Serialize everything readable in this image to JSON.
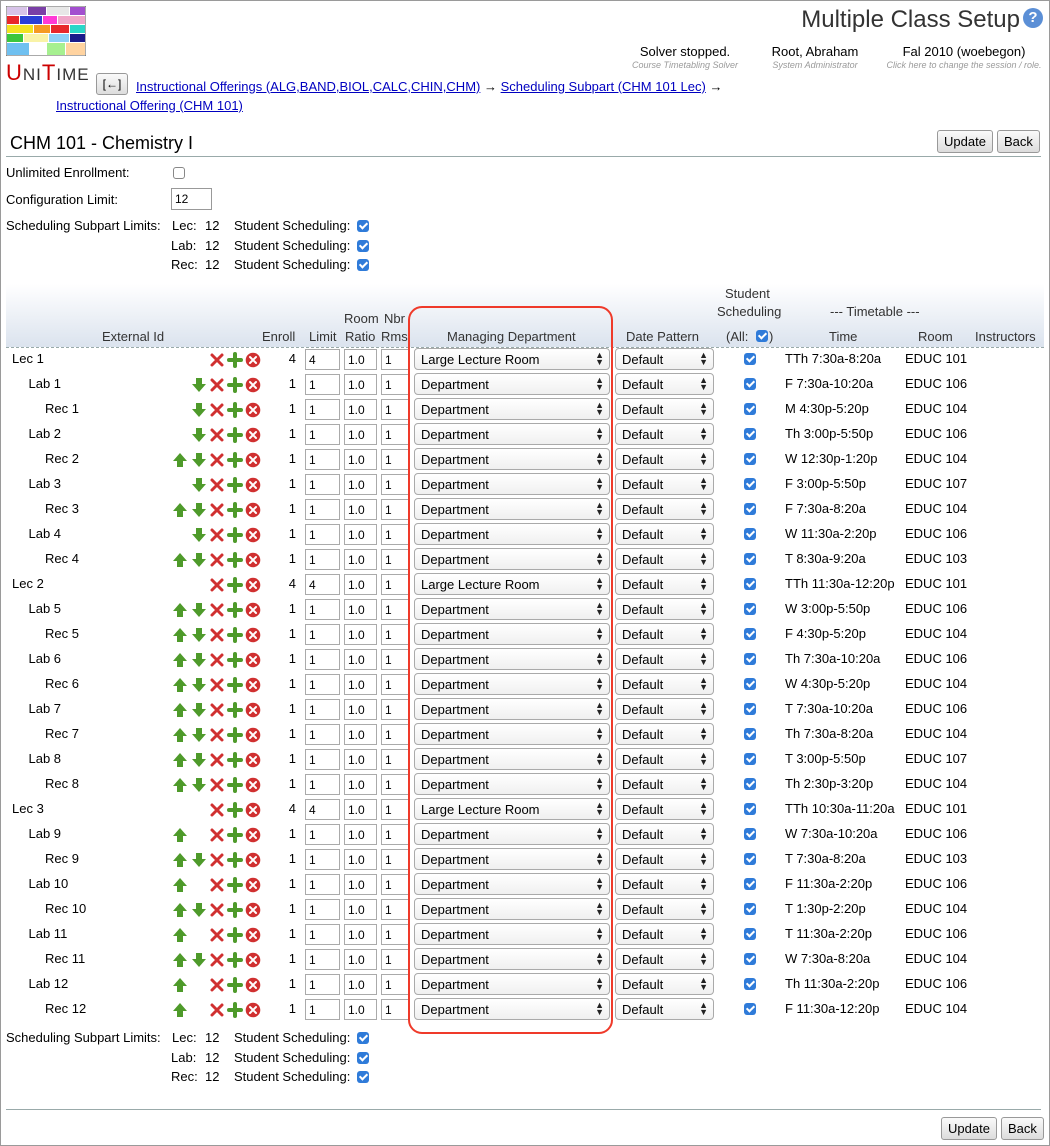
{
  "header": {
    "title": "Multiple Class Setup",
    "logo_text": "UniTime",
    "solver": {
      "main": "Solver stopped.",
      "sub": "Course Timetabling Solver"
    },
    "user": {
      "main": "Root, Abraham",
      "sub": "System Administrator"
    },
    "session": {
      "main": "Fal 2010 (woebegon)",
      "sub": "Click here to change the session / role."
    },
    "help": "?"
  },
  "nav": {
    "back_label": "[←]",
    "crumb1": "Instructional Offerings (ALG,BAND,BIOL,CALC,CHIN,CHM)",
    "sep": "→",
    "crumb2": "Scheduling Subpart (CHM 101 Lec)",
    "crumb3": "Instructional Offering (CHM 101)"
  },
  "course_title": "CHM 101 - Chemistry I",
  "buttons": {
    "update": "Update",
    "back": "Back"
  },
  "form": {
    "unlimited_label": "Unlimited Enrollment:",
    "config_label": "Configuration Limit:",
    "config_value": "12",
    "subpart_limits_label": "Scheduling Subpart Limits:",
    "student_scheduling_label": "Student Scheduling:",
    "subpart_limits": [
      {
        "type": "Lec:",
        "limit": "12"
      },
      {
        "type": "Lab:",
        "limit": "12"
      },
      {
        "type": "Rec:",
        "limit": "12"
      }
    ]
  },
  "table": {
    "headers": {
      "external_id": "External Id",
      "enroll": "Enroll",
      "limit": "Limit",
      "room_ratio_1": "Room",
      "room_ratio_2": "Ratio",
      "nbr_rms_1": "Nbr",
      "nbr_rms_2": "Rms",
      "managing_dept": "Managing Department",
      "date_pattern": "Date Pattern",
      "student_sched_1": "Student",
      "student_sched_2": "Scheduling",
      "all_open": "(All:",
      "all_close": ")",
      "timetable": "--- Timetable ---",
      "time": "Time",
      "room": "Room",
      "instructors": "Instructors"
    },
    "rows": [
      {
        "name": "Lec 1",
        "indent": 0,
        "up": false,
        "down": false,
        "enroll": "4",
        "limit": "4",
        "ratio": "1.0",
        "rooms": "1",
        "dept": "Large Lecture Room",
        "date": "Default",
        "time": "TTh 7:30a-8:20a",
        "room": "EDUC 101"
      },
      {
        "name": "Lab 1",
        "indent": 1,
        "up": false,
        "down": true,
        "enroll": "1",
        "limit": "1",
        "ratio": "1.0",
        "rooms": "1",
        "dept": "Department",
        "date": "Default",
        "time": "F 7:30a-10:20a",
        "room": "EDUC 106"
      },
      {
        "name": "Rec 1",
        "indent": 2,
        "up": false,
        "down": true,
        "enroll": "1",
        "limit": "1",
        "ratio": "1.0",
        "rooms": "1",
        "dept": "Department",
        "date": "Default",
        "time": "M 4:30p-5:20p",
        "room": "EDUC 104"
      },
      {
        "name": "Lab 2",
        "indent": 1,
        "up": false,
        "down": true,
        "enroll": "1",
        "limit": "1",
        "ratio": "1.0",
        "rooms": "1",
        "dept": "Department",
        "date": "Default",
        "time": "Th 3:00p-5:50p",
        "room": "EDUC 106"
      },
      {
        "name": "Rec 2",
        "indent": 2,
        "up": true,
        "down": true,
        "enroll": "1",
        "limit": "1",
        "ratio": "1.0",
        "rooms": "1",
        "dept": "Department",
        "date": "Default",
        "time": "W 12:30p-1:20p",
        "room": "EDUC 104"
      },
      {
        "name": "Lab 3",
        "indent": 1,
        "up": false,
        "down": true,
        "enroll": "1",
        "limit": "1",
        "ratio": "1.0",
        "rooms": "1",
        "dept": "Department",
        "date": "Default",
        "time": "F 3:00p-5:50p",
        "room": "EDUC 107"
      },
      {
        "name": "Rec 3",
        "indent": 2,
        "up": true,
        "down": true,
        "enroll": "1",
        "limit": "1",
        "ratio": "1.0",
        "rooms": "1",
        "dept": "Department",
        "date": "Default",
        "time": "F 7:30a-8:20a",
        "room": "EDUC 104"
      },
      {
        "name": "Lab 4",
        "indent": 1,
        "up": false,
        "down": true,
        "enroll": "1",
        "limit": "1",
        "ratio": "1.0",
        "rooms": "1",
        "dept": "Department",
        "date": "Default",
        "time": "W 11:30a-2:20p",
        "room": "EDUC 106"
      },
      {
        "name": "Rec 4",
        "indent": 2,
        "up": true,
        "down": true,
        "enroll": "1",
        "limit": "1",
        "ratio": "1.0",
        "rooms": "1",
        "dept": "Department",
        "date": "Default",
        "time": "T 8:30a-9:20a",
        "room": "EDUC 103"
      },
      {
        "name": "Lec 2",
        "indent": 0,
        "up": false,
        "down": false,
        "enroll": "4",
        "limit": "4",
        "ratio": "1.0",
        "rooms": "1",
        "dept": "Large Lecture Room",
        "date": "Default",
        "time": "TTh 11:30a-12:20p",
        "room": "EDUC 101"
      },
      {
        "name": "Lab 5",
        "indent": 1,
        "up": true,
        "down": true,
        "enroll": "1",
        "limit": "1",
        "ratio": "1.0",
        "rooms": "1",
        "dept": "Department",
        "date": "Default",
        "time": "W 3:00p-5:50p",
        "room": "EDUC 106"
      },
      {
        "name": "Rec 5",
        "indent": 2,
        "up": true,
        "down": true,
        "enroll": "1",
        "limit": "1",
        "ratio": "1.0",
        "rooms": "1",
        "dept": "Department",
        "date": "Default",
        "time": "F 4:30p-5:20p",
        "room": "EDUC 104"
      },
      {
        "name": "Lab 6",
        "indent": 1,
        "up": true,
        "down": true,
        "enroll": "1",
        "limit": "1",
        "ratio": "1.0",
        "rooms": "1",
        "dept": "Department",
        "date": "Default",
        "time": "Th 7:30a-10:20a",
        "room": "EDUC 106"
      },
      {
        "name": "Rec 6",
        "indent": 2,
        "up": true,
        "down": true,
        "enroll": "1",
        "limit": "1",
        "ratio": "1.0",
        "rooms": "1",
        "dept": "Department",
        "date": "Default",
        "time": "W 4:30p-5:20p",
        "room": "EDUC 104"
      },
      {
        "name": "Lab 7",
        "indent": 1,
        "up": true,
        "down": true,
        "enroll": "1",
        "limit": "1",
        "ratio": "1.0",
        "rooms": "1",
        "dept": "Department",
        "date": "Default",
        "time": "T 7:30a-10:20a",
        "room": "EDUC 106"
      },
      {
        "name": "Rec 7",
        "indent": 2,
        "up": true,
        "down": true,
        "enroll": "1",
        "limit": "1",
        "ratio": "1.0",
        "rooms": "1",
        "dept": "Department",
        "date": "Default",
        "time": "Th 7:30a-8:20a",
        "room": "EDUC 104"
      },
      {
        "name": "Lab 8",
        "indent": 1,
        "up": true,
        "down": true,
        "enroll": "1",
        "limit": "1",
        "ratio": "1.0",
        "rooms": "1",
        "dept": "Department",
        "date": "Default",
        "time": "T 3:00p-5:50p",
        "room": "EDUC 107"
      },
      {
        "name": "Rec 8",
        "indent": 2,
        "up": true,
        "down": true,
        "enroll": "1",
        "limit": "1",
        "ratio": "1.0",
        "rooms": "1",
        "dept": "Department",
        "date": "Default",
        "time": "Th 2:30p-3:20p",
        "room": "EDUC 104"
      },
      {
        "name": "Lec 3",
        "indent": 0,
        "up": false,
        "down": false,
        "enroll": "4",
        "limit": "4",
        "ratio": "1.0",
        "rooms": "1",
        "dept": "Large Lecture Room",
        "date": "Default",
        "time": "TTh 10:30a-11:20a",
        "room": "EDUC 101"
      },
      {
        "name": "Lab 9",
        "indent": 1,
        "up": true,
        "down": false,
        "enroll": "1",
        "limit": "1",
        "ratio": "1.0",
        "rooms": "1",
        "dept": "Department",
        "date": "Default",
        "time": "W 7:30a-10:20a",
        "room": "EDUC 106"
      },
      {
        "name": "Rec 9",
        "indent": 2,
        "up": true,
        "down": true,
        "enroll": "1",
        "limit": "1",
        "ratio": "1.0",
        "rooms": "1",
        "dept": "Department",
        "date": "Default",
        "time": "T 7:30a-8:20a",
        "room": "EDUC 103"
      },
      {
        "name": "Lab 10",
        "indent": 1,
        "up": true,
        "down": false,
        "enroll": "1",
        "limit": "1",
        "ratio": "1.0",
        "rooms": "1",
        "dept": "Department",
        "date": "Default",
        "time": "F 11:30a-2:20p",
        "room": "EDUC 106"
      },
      {
        "name": "Rec 10",
        "indent": 2,
        "up": true,
        "down": true,
        "enroll": "1",
        "limit": "1",
        "ratio": "1.0",
        "rooms": "1",
        "dept": "Department",
        "date": "Default",
        "time": "T 1:30p-2:20p",
        "room": "EDUC 104"
      },
      {
        "name": "Lab 11",
        "indent": 1,
        "up": true,
        "down": false,
        "enroll": "1",
        "limit": "1",
        "ratio": "1.0",
        "rooms": "1",
        "dept": "Department",
        "date": "Default",
        "time": "T 11:30a-2:20p",
        "room": "EDUC 106"
      },
      {
        "name": "Rec 11",
        "indent": 2,
        "up": true,
        "down": true,
        "enroll": "1",
        "limit": "1",
        "ratio": "1.0",
        "rooms": "1",
        "dept": "Department",
        "date": "Default",
        "time": "W 7:30a-8:20a",
        "room": "EDUC 104"
      },
      {
        "name": "Lab 12",
        "indent": 1,
        "up": true,
        "down": false,
        "enroll": "1",
        "limit": "1",
        "ratio": "1.0",
        "rooms": "1",
        "dept": "Department",
        "date": "Default",
        "time": "Th 11:30a-2:20p",
        "room": "EDUC 106"
      },
      {
        "name": "Rec 12",
        "indent": 2,
        "up": true,
        "down": false,
        "enroll": "1",
        "limit": "1",
        "ratio": "1.0",
        "rooms": "1",
        "dept": "Department",
        "date": "Default",
        "time": "F 11:30a-12:20p",
        "room": "EDUC 104"
      }
    ]
  },
  "colors": {
    "accent_link": "#0000c0",
    "arrow_green": "#4e9a2a",
    "remove_red": "#d03030",
    "highlight_red": "#ef3a2a",
    "checkbox_blue": "#2f7bd9"
  }
}
